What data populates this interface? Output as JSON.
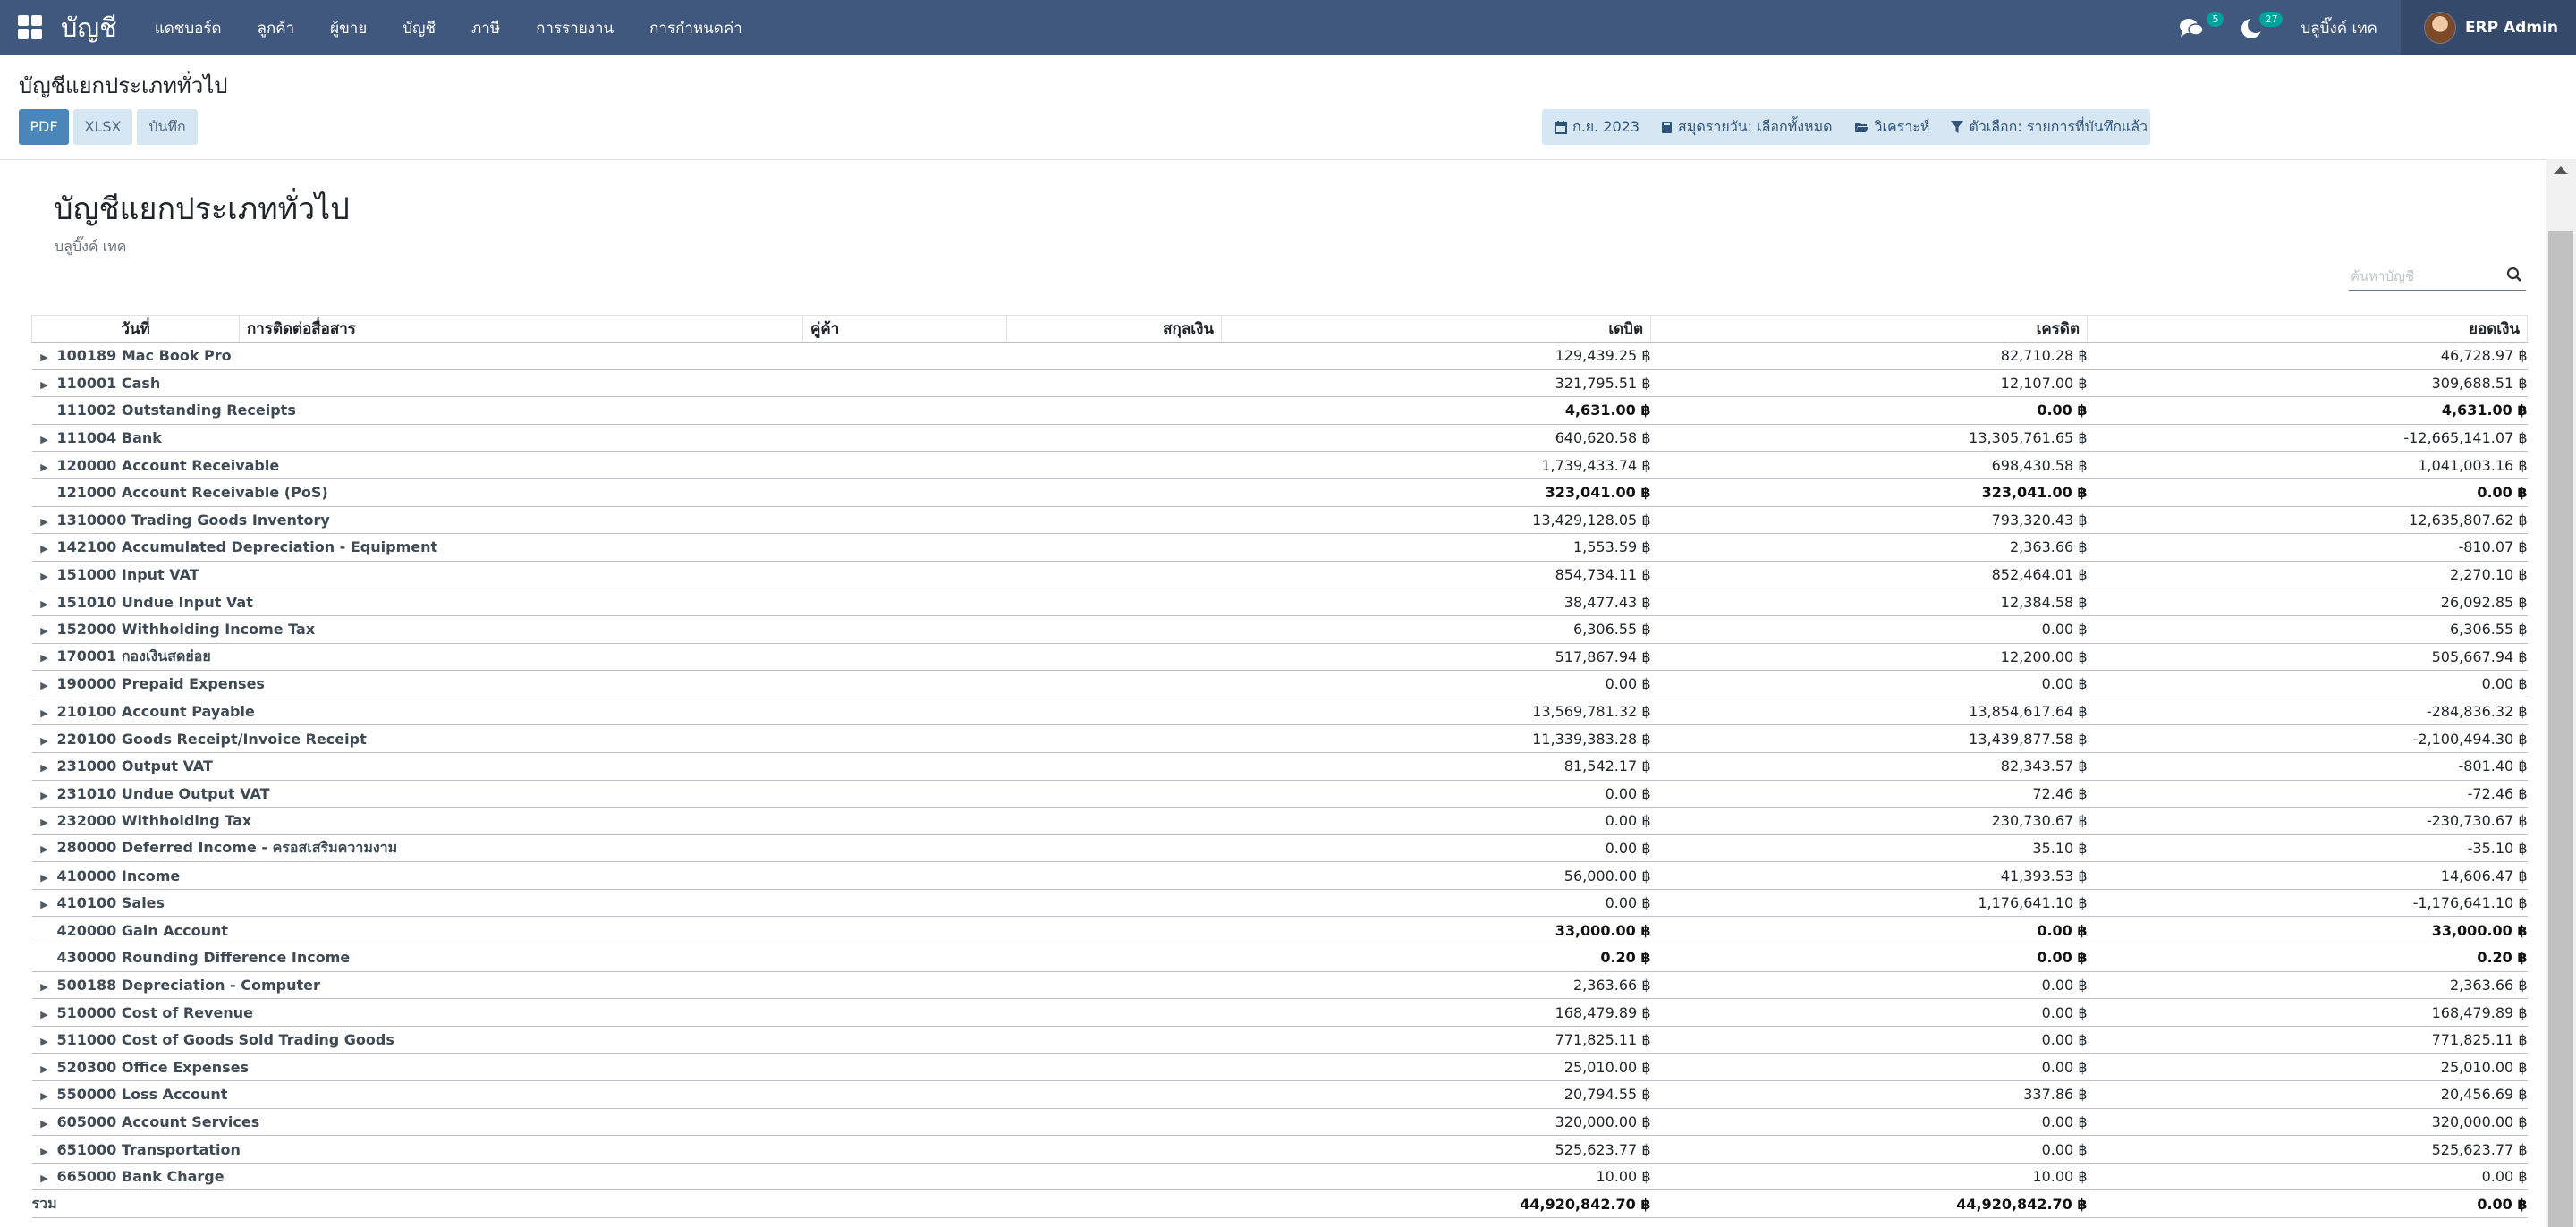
{
  "navbar": {
    "app_name": "บัญชี",
    "menu": [
      "แดชบอร์ด",
      "ลูกค้า",
      "ผู้ขาย",
      "บัญชี",
      "ภาษี",
      "การรายงาน",
      "การกำหนดค่า"
    ],
    "messages_count": "5",
    "activities_count": "27",
    "company": "บลูบิ๊งค์ เทค",
    "user": "ERP Admin",
    "icons": {
      "apps": "grid-icon",
      "messages": "chat-icon",
      "activities": "moon-icon"
    }
  },
  "control_panel": {
    "breadcrumb": "บัญชีแยกประเภททั่วไป",
    "buttons": {
      "pdf": "PDF",
      "xlsx": "XLSX",
      "save": "บันทึก"
    },
    "filters": {
      "date": "ก.ย. 2023",
      "journals": "สมุดรายวัน: เลือกทั้งหมด",
      "analytic": "วิเคราะห์",
      "options": "ตัวเลือก: รายการที่บันทึกแล้ว"
    }
  },
  "report": {
    "title": "บัญชีแยกประเภททั่วไป",
    "company": "บลูบิ๊งค์ เทค",
    "search_placeholder": "ค้นหาบัญชี",
    "columns": {
      "date": "วันที่",
      "communication": "การติดต่อสื่อสาร",
      "partner": "คู่ค้า",
      "currency": "สกุลเงิน",
      "debit": "เดบิต",
      "credit": "เครดิต",
      "balance": "ยอดเงิน"
    },
    "rows": [
      {
        "account": "100189 Mac Book Pro",
        "debit": "129,439.25 ฿",
        "credit": "82,710.28 ฿",
        "balance": "46,728.97 ฿",
        "expandable": true
      },
      {
        "account": "110001 Cash",
        "debit": "321,795.51 ฿",
        "credit": "12,107.00 ฿",
        "balance": "309,688.51 ฿",
        "expandable": true
      },
      {
        "account": "111002 Outstanding Receipts",
        "debit": "4,631.00 ฿",
        "credit": "0.00 ฿",
        "balance": "4,631.00 ฿",
        "expandable": false
      },
      {
        "account": "111004 Bank",
        "debit": "640,620.58 ฿",
        "credit": "13,305,761.65 ฿",
        "balance": "-12,665,141.07 ฿",
        "expandable": true
      },
      {
        "account": "120000 Account Receivable",
        "debit": "1,739,433.74 ฿",
        "credit": "698,430.58 ฿",
        "balance": "1,041,003.16 ฿",
        "expandable": true
      },
      {
        "account": "121000 Account Receivable (PoS)",
        "debit": "323,041.00 ฿",
        "credit": "323,041.00 ฿",
        "balance": "0.00 ฿",
        "expandable": false
      },
      {
        "account": "1310000 Trading Goods Inventory",
        "debit": "13,429,128.05 ฿",
        "credit": "793,320.43 ฿",
        "balance": "12,635,807.62 ฿",
        "expandable": true
      },
      {
        "account": "142100 Accumulated Depreciation - Equipment",
        "debit": "1,553.59 ฿",
        "credit": "2,363.66 ฿",
        "balance": "-810.07 ฿",
        "expandable": true
      },
      {
        "account": "151000 Input VAT",
        "debit": "854,734.11 ฿",
        "credit": "852,464.01 ฿",
        "balance": "2,270.10 ฿",
        "expandable": true
      },
      {
        "account": "151010 Undue Input Vat",
        "debit": "38,477.43 ฿",
        "credit": "12,384.58 ฿",
        "balance": "26,092.85 ฿",
        "expandable": true
      },
      {
        "account": "152000 Withholding Income Tax",
        "debit": "6,306.55 ฿",
        "credit": "0.00 ฿",
        "balance": "6,306.55 ฿",
        "expandable": true
      },
      {
        "account": "170001 กองเงินสดย่อย",
        "debit": "517,867.94 ฿",
        "credit": "12,200.00 ฿",
        "balance": "505,667.94 ฿",
        "expandable": true
      },
      {
        "account": "190000 Prepaid Expenses",
        "debit": "0.00 ฿",
        "credit": "0.00 ฿",
        "balance": "0.00 ฿",
        "expandable": true
      },
      {
        "account": "210100 Account Payable",
        "debit": "13,569,781.32 ฿",
        "credit": "13,854,617.64 ฿",
        "balance": "-284,836.32 ฿",
        "expandable": true
      },
      {
        "account": "220100 Goods Receipt/Invoice Receipt",
        "debit": "11,339,383.28 ฿",
        "credit": "13,439,877.58 ฿",
        "balance": "-2,100,494.30 ฿",
        "expandable": true
      },
      {
        "account": "231000 Output VAT",
        "debit": "81,542.17 ฿",
        "credit": "82,343.57 ฿",
        "balance": "-801.40 ฿",
        "expandable": true
      },
      {
        "account": "231010 Undue Output VAT",
        "debit": "0.00 ฿",
        "credit": "72.46 ฿",
        "balance": "-72.46 ฿",
        "expandable": true
      },
      {
        "account": "232000 Withholding Tax",
        "debit": "0.00 ฿",
        "credit": "230,730.67 ฿",
        "balance": "-230,730.67 ฿",
        "expandable": true
      },
      {
        "account": "280000 Deferred Income - ครอสเสริมความงาม",
        "debit": "0.00 ฿",
        "credit": "35.10 ฿",
        "balance": "-35.10 ฿",
        "expandable": true
      },
      {
        "account": "410000 Income",
        "debit": "56,000.00 ฿",
        "credit": "41,393.53 ฿",
        "balance": "14,606.47 ฿",
        "expandable": true
      },
      {
        "account": "410100 Sales",
        "debit": "0.00 ฿",
        "credit": "1,176,641.10 ฿",
        "balance": "-1,176,641.10 ฿",
        "expandable": true
      },
      {
        "account": "420000 Gain Account",
        "debit": "33,000.00 ฿",
        "credit": "0.00 ฿",
        "balance": "33,000.00 ฿",
        "expandable": false
      },
      {
        "account": "430000 Rounding Difference Income",
        "debit": "0.20 ฿",
        "credit": "0.00 ฿",
        "balance": "0.20 ฿",
        "expandable": false
      },
      {
        "account": "500188 Depreciation - Computer",
        "debit": "2,363.66 ฿",
        "credit": "0.00 ฿",
        "balance": "2,363.66 ฿",
        "expandable": true
      },
      {
        "account": "510000 Cost of Revenue",
        "debit": "168,479.89 ฿",
        "credit": "0.00 ฿",
        "balance": "168,479.89 ฿",
        "expandable": true
      },
      {
        "account": "511000 Cost of Goods Sold Trading Goods",
        "debit": "771,825.11 ฿",
        "credit": "0.00 ฿",
        "balance": "771,825.11 ฿",
        "expandable": true
      },
      {
        "account": "520300 Office Expenses",
        "debit": "25,010.00 ฿",
        "credit": "0.00 ฿",
        "balance": "25,010.00 ฿",
        "expandable": true
      },
      {
        "account": "550000 Loss Account",
        "debit": "20,794.55 ฿",
        "credit": "337.86 ฿",
        "balance": "20,456.69 ฿",
        "expandable": true
      },
      {
        "account": "605000 Account Services",
        "debit": "320,000.00 ฿",
        "credit": "0.00 ฿",
        "balance": "320,000.00 ฿",
        "expandable": true
      },
      {
        "account": "651000 Transportation",
        "debit": "525,623.77 ฿",
        "credit": "0.00 ฿",
        "balance": "525,623.77 ฿",
        "expandable": true
      },
      {
        "account": "665000 Bank Charge",
        "debit": "10.00 ฿",
        "credit": "10.00 ฿",
        "balance": "0.00 ฿",
        "expandable": true
      }
    ],
    "total": {
      "label": "รวม",
      "debit": "44,920,842.70 ฿",
      "credit": "44,920,842.70 ฿",
      "balance": "0.00 ฿"
    }
  },
  "colors": {
    "navbar": "#40577e",
    "user_box": "#35496b",
    "primary_button": "#4a86b9",
    "secondary_button": "#d6e6f2",
    "badge": "#00a09d"
  }
}
